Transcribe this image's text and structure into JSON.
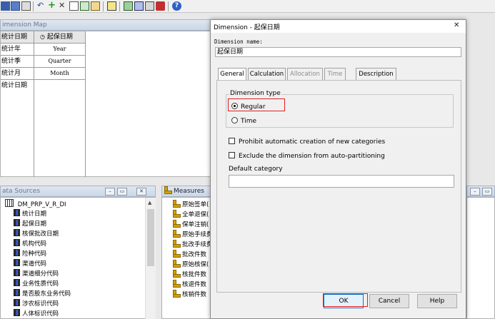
{
  "dimension_map": {
    "title": "imension Map",
    "rows": [
      "统计日期",
      "统计年",
      "统计季",
      "统计月",
      "统计日期"
    ],
    "header": "起保日期",
    "levels": [
      "Year",
      "Quarter",
      "Month"
    ]
  },
  "data_sources": {
    "title": "ata Sources",
    "root": "DM_PRP_V_R_DI",
    "columns": [
      "统计日期",
      "起保日期",
      "核保批改日期",
      "机构代码",
      "险种代码",
      "渠道代码",
      "渠道细分代码",
      "业务性质代码",
      "是否股东业务代码",
      "涉农标识代码",
      "人体标识代码"
    ]
  },
  "measures": {
    "title": "Measures",
    "items": [
      "原始签单(",
      "全单退保(",
      "保单注销(",
      "原始手续费",
      "批改手续费",
      "批改件数",
      "原始核保(",
      "核批件数",
      "核退件数",
      "核销件数"
    ]
  },
  "dialog": {
    "title": "Dimension - 起保日期",
    "close": "✕",
    "name_label": "Dimension name:",
    "name_value": "起保日期",
    "tabs": [
      "General",
      "Calculation",
      "Allocation",
      "Time",
      "Description"
    ],
    "type_group": "Dimension type",
    "type_regular": "Regular",
    "type_time": "Time",
    "prohibit_label": "Prohibit automatic creation of new categories",
    "exclude_label": "Exclude the dimension from auto-partitioning",
    "default_category_label": "Default category",
    "default_category_value": "",
    "ok": "OK",
    "cancel": "Cancel",
    "help": "Help"
  },
  "colors": {
    "highlight": "#e02020",
    "strip": "#cbd7e6"
  }
}
